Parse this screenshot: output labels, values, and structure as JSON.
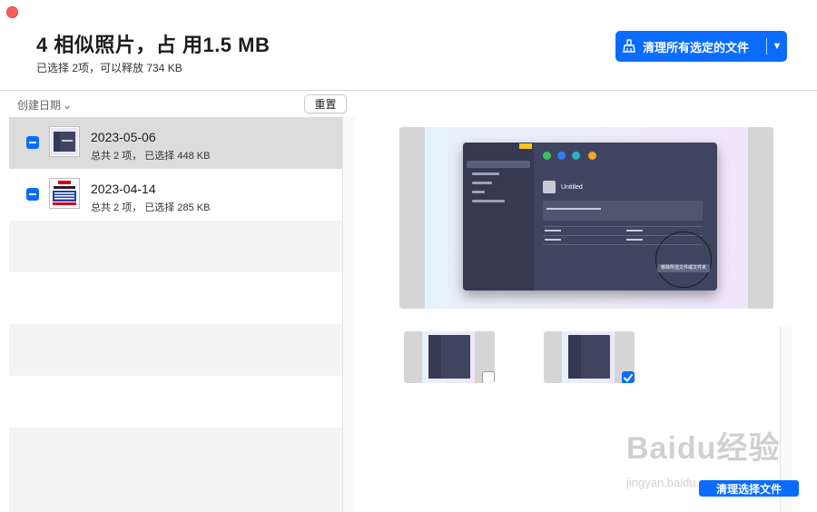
{
  "window": {
    "title": "4 相似照片，占 用1.5 MB",
    "subtitle": "已选择 2项，可以释放 734 KB"
  },
  "toolbar": {
    "clean_selected_label": "清理所有选定的文件",
    "clean_caret": "▼",
    "sort_label": "创建日期",
    "sort_caret": "⌄",
    "reset_label": "重置"
  },
  "groups": [
    {
      "date": "2023-05-06",
      "summary": "总共 2 项， 已选择 448 KB",
      "selected": true,
      "checked": "mixed"
    },
    {
      "date": "2023-04-14",
      "summary": "总共 2 项， 已选择 285 KB",
      "selected": false,
      "checked": "mixed"
    }
  ],
  "preview": {
    "app_heading": "Untitled",
    "action_label": "移除所选文件或文件夹"
  },
  "thumbnails": [
    {
      "checked": false
    },
    {
      "checked": true
    }
  ],
  "footer": {
    "clean_button_label": "清理选择文件"
  },
  "watermark": {
    "brand": "Baidu经验",
    "url": "jingyan.baidu.com"
  },
  "colors": {
    "accent": "#0a6cff",
    "close": "#ff5f57"
  },
  "icons": {
    "clean": "broom-icon",
    "close": "close-dot-icon"
  }
}
